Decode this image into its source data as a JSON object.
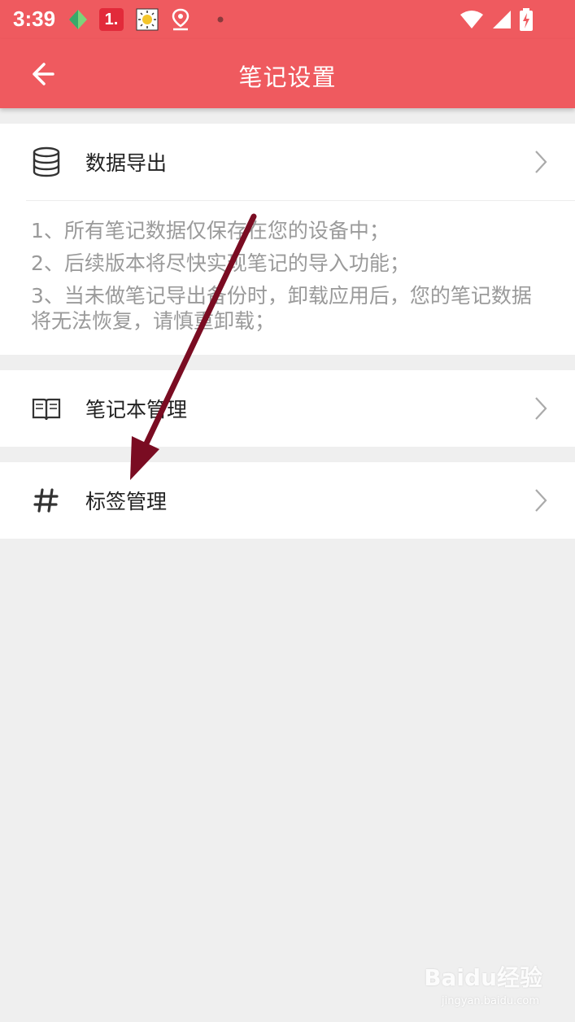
{
  "status_bar": {
    "time": "3:39",
    "notification_badge": "1."
  },
  "app_bar": {
    "title": "笔记设置"
  },
  "settings": {
    "export": {
      "label": "数据导出",
      "icon": "database-icon"
    },
    "notes": [
      "1、所有笔记数据仅保存在您的设备中；",
      "2、后续版本将尽快实现笔记的导入功能；",
      "3、当未做笔记导出备份时，卸载应用后，您的笔记数据将无法恢复，请慎重卸载；"
    ],
    "notebook_manage": {
      "label": "笔记本管理",
      "icon": "book-icon"
    },
    "tag_manage": {
      "label": "标签管理",
      "icon": "hashtag-icon"
    }
  },
  "watermark": {
    "brand": "Baidu经验",
    "url": "jingyan.baidu.com"
  },
  "colors": {
    "primary": "#ef5a5f",
    "background": "#efefef",
    "annotation_arrow": "#7a0c22"
  }
}
